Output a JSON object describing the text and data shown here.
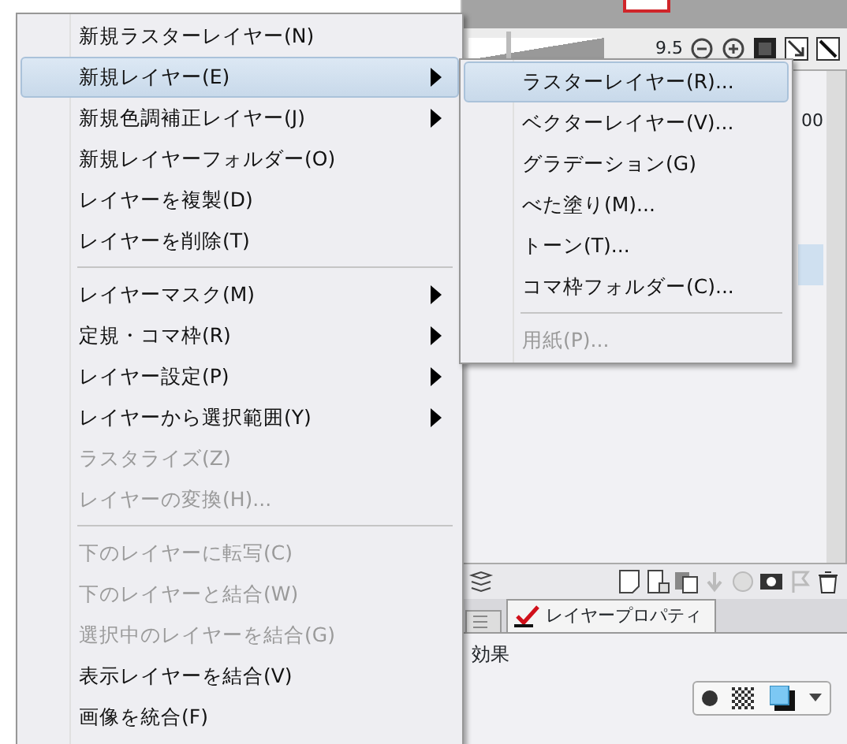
{
  "panel": {
    "zoom_slider": {
      "level": 0.28
    },
    "zoom_value": "9.5",
    "opacity_value": "00",
    "tab": {
      "label": "レイヤープロパティ",
      "selected": true
    },
    "section_label": "効果"
  },
  "menu": {
    "items": [
      {
        "kind": "item",
        "label": "新規ラスターレイヤー(N)",
        "submenu": false,
        "disabled": false,
        "highlighted": false
      },
      {
        "kind": "item",
        "label": "新規レイヤー(E)",
        "submenu": true,
        "disabled": false,
        "highlighted": true
      },
      {
        "kind": "item",
        "label": "新規色調補正レイヤー(J)",
        "submenu": true,
        "disabled": false,
        "highlighted": false
      },
      {
        "kind": "item",
        "label": "新規レイヤーフォルダー(O)",
        "submenu": false,
        "disabled": false,
        "highlighted": false
      },
      {
        "kind": "item",
        "label": "レイヤーを複製(D)",
        "submenu": false,
        "disabled": false,
        "highlighted": false
      },
      {
        "kind": "item",
        "label": "レイヤーを削除(T)",
        "submenu": false,
        "disabled": false,
        "highlighted": false
      },
      {
        "kind": "separator"
      },
      {
        "kind": "item",
        "label": "レイヤーマスク(M)",
        "submenu": true,
        "disabled": false,
        "highlighted": false
      },
      {
        "kind": "item",
        "label": "定規・コマ枠(R)",
        "submenu": true,
        "disabled": false,
        "highlighted": false
      },
      {
        "kind": "item",
        "label": "レイヤー設定(P)",
        "submenu": true,
        "disabled": false,
        "highlighted": false
      },
      {
        "kind": "item",
        "label": "レイヤーから選択範囲(Y)",
        "submenu": true,
        "disabled": false,
        "highlighted": false
      },
      {
        "kind": "item",
        "label": "ラスタライズ(Z)",
        "submenu": false,
        "disabled": true,
        "highlighted": false
      },
      {
        "kind": "item",
        "label": "レイヤーの変換(H)...",
        "submenu": false,
        "disabled": true,
        "highlighted": false
      },
      {
        "kind": "separator"
      },
      {
        "kind": "item",
        "label": "下のレイヤーに転写(C)",
        "submenu": false,
        "disabled": true,
        "highlighted": false
      },
      {
        "kind": "item",
        "label": "下のレイヤーと結合(W)",
        "submenu": false,
        "disabled": true,
        "highlighted": false
      },
      {
        "kind": "item",
        "label": "選択中のレイヤーを結合(G)",
        "submenu": false,
        "disabled": true,
        "highlighted": false
      },
      {
        "kind": "item",
        "label": "表示レイヤーを結合(V)",
        "submenu": false,
        "disabled": false,
        "highlighted": false
      },
      {
        "kind": "item",
        "label": "画像を統合(F)",
        "submenu": false,
        "disabled": false,
        "highlighted": false
      }
    ]
  },
  "submenu": {
    "items": [
      {
        "kind": "item",
        "label": "ラスターレイヤー(R)...",
        "submenu": false,
        "disabled": false,
        "highlighted": true
      },
      {
        "kind": "item",
        "label": "ベクターレイヤー(V)...",
        "submenu": false,
        "disabled": false,
        "highlighted": false
      },
      {
        "kind": "item",
        "label": "グラデーション(G)",
        "submenu": false,
        "disabled": false,
        "highlighted": false
      },
      {
        "kind": "item",
        "label": "べた塗り(M)...",
        "submenu": false,
        "disabled": false,
        "highlighted": false
      },
      {
        "kind": "item",
        "label": "トーン(T)...",
        "submenu": false,
        "disabled": false,
        "highlighted": false
      },
      {
        "kind": "item",
        "label": "コマ枠フォルダー(C)...",
        "submenu": false,
        "disabled": false,
        "highlighted": false
      },
      {
        "kind": "separator"
      },
      {
        "kind": "item",
        "label": "用紙(P)...",
        "submenu": false,
        "disabled": true,
        "highlighted": false
      }
    ]
  }
}
